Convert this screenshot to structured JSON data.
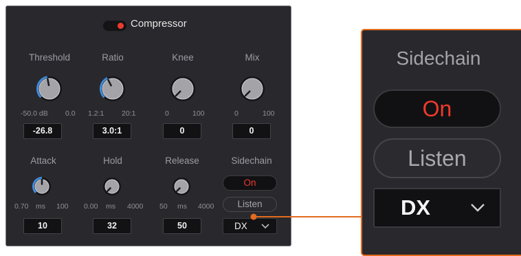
{
  "header": {
    "title": "Compressor",
    "toggle_on": true
  },
  "parameters": [
    {
      "label": "Threshold",
      "min": "-50.0 dB",
      "unit": "",
      "max": "0.0",
      "value": "-26.8",
      "level": 0.46
    },
    {
      "label": "Ratio",
      "min": "1.2:1",
      "unit": "",
      "max": "20:1",
      "value": "3.0:1",
      "level": 0.4
    },
    {
      "label": "Knee",
      "min": "0",
      "unit": "",
      "max": "100",
      "value": "0",
      "level": 0
    },
    {
      "label": "Mix",
      "min": "0",
      "unit": "",
      "max": "100",
      "value": "0",
      "level": 0
    },
    {
      "label": "Attack",
      "min": "0.70",
      "unit": "ms",
      "max": "100",
      "value": "10",
      "level": 0.5
    },
    {
      "label": "Hold",
      "min": "0.00",
      "unit": "ms",
      "max": "4000",
      "value": "32",
      "level": 0
    },
    {
      "label": "Release",
      "min": "50",
      "unit": "ms",
      "max": "4000",
      "value": "50",
      "level": 0
    }
  ],
  "sidechain": {
    "label": "Sidechain",
    "on_label": "On",
    "listen_label": "Listen",
    "source_value": "DX"
  },
  "zoom": {
    "title": "Sidechain",
    "on_label": "On",
    "listen_label": "Listen",
    "source_value": "DX"
  },
  "colors": {
    "accent": "#e36b1e",
    "on_red": "#ec3b2e",
    "arc_blue": "#3d8de0",
    "panel_bg": "#29292d"
  }
}
